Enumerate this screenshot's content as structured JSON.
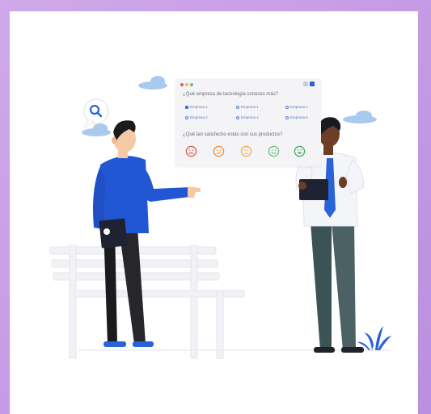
{
  "survey": {
    "question1": "¿Qué empresa de tecnología conoces más?",
    "options": [
      "Empresa 1",
      "Empresa 1",
      "Empresa 1",
      "Empresa 2",
      "Empresa 4",
      "Empresa 6"
    ],
    "selected_option_index": 0,
    "question2": "¿Qué tan satisfecho estás con sus productos?",
    "rating_faces": [
      "very-dissatisfied-face-icon",
      "dissatisfied-face-icon",
      "neutral-face-icon",
      "satisfied-face-icon",
      "very-satisfied-face-icon"
    ],
    "rating_colors": [
      "#e05a4f",
      "#f08a3c",
      "#f5a94a",
      "#6cc17a",
      "#3fae5b"
    ]
  },
  "colors": {
    "background": "#c79ce6",
    "card": "#ffffff",
    "accent_blue": "#2a62d8",
    "cloud": "#a9c9ef"
  }
}
